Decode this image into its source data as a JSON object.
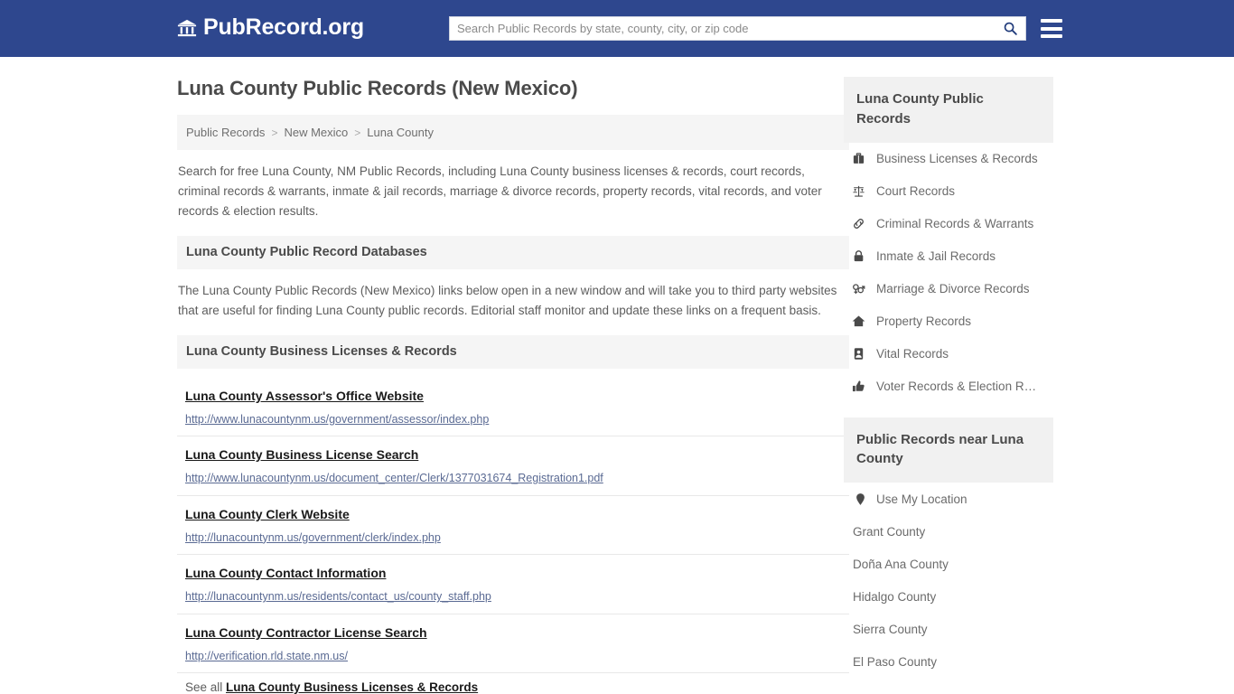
{
  "header": {
    "brand_name": "PubRecord.org",
    "brand_icon": "bank-icon",
    "search": {
      "placeholder": "Search Public Records by state, county, city, or zip code",
      "value": "",
      "icon": "search-icon"
    },
    "menu_icon": "hamburger-menu-icon"
  },
  "main": {
    "page_title": "Luna County Public Records (New Mexico)",
    "breadcrumb": [
      {
        "label": "Public Records"
      },
      {
        "label": "New Mexico"
      },
      {
        "label": "Luna County"
      }
    ],
    "breadcrumb_separator": ">",
    "intro": "Search for free Luna County, NM Public Records, including Luna County business licenses & records, court records, criminal records & warrants, inmate & jail records, marriage & divorce records, property records, vital records, and voter records & election results.",
    "databases_heading": "Luna County Public Record Databases",
    "databases_text": "The Luna County Public Records (New Mexico) links below open in a new window and will take you to third party websites that are useful for finding Luna County public records. Editorial staff monitor and update these links on a frequent basis.",
    "section_heading": "Luna County Business Licenses & Records",
    "links": [
      {
        "title": "Luna County Assessor's Office Website",
        "url": "http://www.lunacountynm.us/government/assessor/index.php"
      },
      {
        "title": "Luna County Business License Search",
        "url": "http://www.lunacountynm.us/document_center/Clerk/1377031674_Registration1.pdf"
      },
      {
        "title": "Luna County Clerk Website",
        "url": "http://lunacountynm.us/government/clerk/index.php"
      },
      {
        "title": "Luna County Contact Information",
        "url": "http://lunacountynm.us/residents/contact_us/county_staff.php"
      },
      {
        "title": "Luna County Contractor License Search",
        "url": "http://verification.rld.state.nm.us/"
      }
    ],
    "see_all_prefix": "See all ",
    "see_all_link": "Luna County Business Licenses & Records"
  },
  "sidebar": {
    "records_heading": "Luna County Public Records",
    "records_items": [
      {
        "label": "Business Licenses & Records",
        "icon": "briefcase-icon"
      },
      {
        "label": "Court Records",
        "icon": "balance-scale-icon"
      },
      {
        "label": "Criminal Records & Warrants",
        "icon": "chain-link-icon"
      },
      {
        "label": "Inmate & Jail Records",
        "icon": "lock-icon"
      },
      {
        "label": "Marriage & Divorce Records",
        "icon": "venus-mars-icon"
      },
      {
        "label": "Property Records",
        "icon": "home-icon"
      },
      {
        "label": "Vital Records",
        "icon": "id-badge-icon"
      },
      {
        "label": "Voter Records & Election R…",
        "icon": "thumbs-up-icon"
      }
    ],
    "near_heading": "Public Records near Luna County",
    "near_items": [
      {
        "label": "Use My Location",
        "icon": "map-pin-icon"
      },
      {
        "label": "Grant County",
        "icon": ""
      },
      {
        "label": "Doña Ana County",
        "icon": ""
      },
      {
        "label": "Hidalgo County",
        "icon": ""
      },
      {
        "label": "Sierra County",
        "icon": ""
      },
      {
        "label": "El Paso County",
        "icon": ""
      }
    ]
  },
  "colors": {
    "header_blue": "#2e478e",
    "panel_gray": "#f5f5f5",
    "link_url_blue": "#5a6a93",
    "text_gray": "#5d5d5d"
  }
}
